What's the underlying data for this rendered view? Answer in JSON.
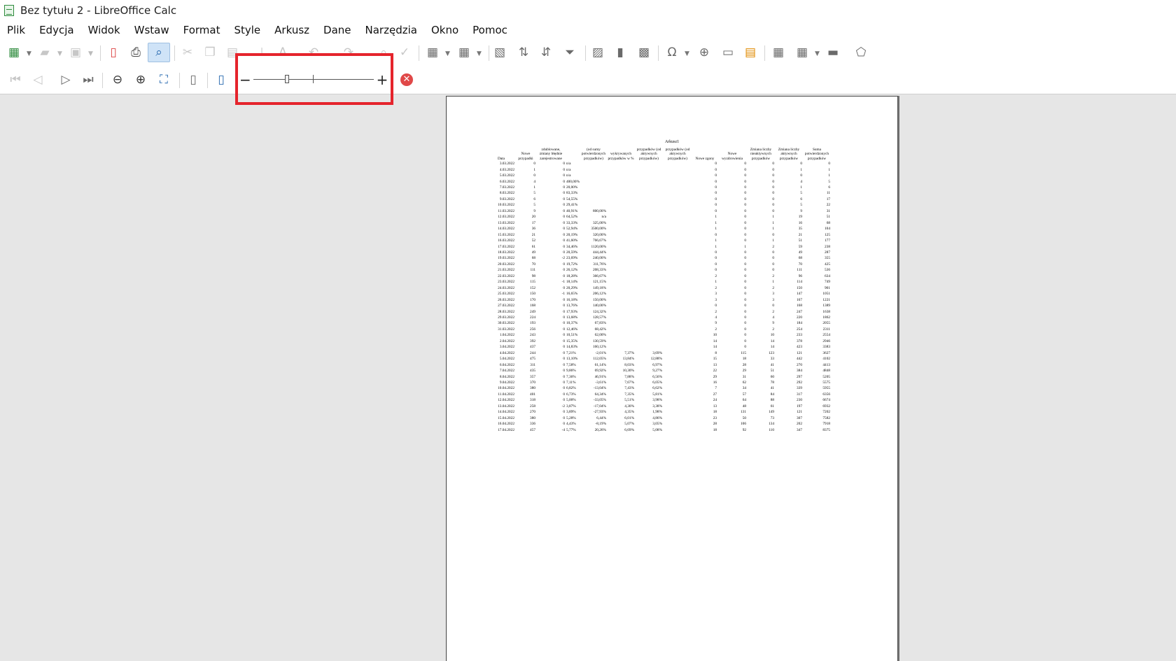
{
  "window": {
    "title": "Bez tytułu 2 - LibreOffice Calc"
  },
  "menu": [
    "Plik",
    "Edycja",
    "Widok",
    "Wstaw",
    "Format",
    "Style",
    "Arkusz",
    "Dane",
    "Narzędzia",
    "Okno",
    "Pomoc"
  ],
  "zoom": {
    "minus": "−",
    "plus": "+",
    "level": 0.3
  },
  "preview": {
    "sheet_name": "Arkusz1",
    "headers": [
      "Data",
      "Nowe przypadki",
      "zdublowane, zmiany błędnie zarejestrowane",
      "(od sumy potwierdzonych przypadków)",
      "wykrywanych przypadków w %",
      "przypadków (od aktywnych przypadków)",
      "przypadków (od aktywnych przypadków)",
      "Nowe zgony",
      "Nowe wyzdrowienia",
      "Zmiana liczby nieaktywnych przypadków",
      "Zmiana liczby aktywnych przypadków",
      "Suma potwierdzonych przypadków"
    ],
    "rows": [
      [
        "3.03.2022",
        "0",
        "0",
        "n/a",
        "",
        "",
        "",
        "",
        "0",
        "0",
        "0",
        "0",
        "0"
      ],
      [
        "4.03.2022",
        "1",
        "0",
        "n/a",
        "",
        "",
        "",
        "",
        "0",
        "0",
        "0",
        "1",
        "1"
      ],
      [
        "5.03.2022",
        "0",
        "0",
        "n/a",
        "",
        "",
        "",
        "",
        "0",
        "0",
        "0",
        "0",
        "1"
      ],
      [
        "6.03.2022",
        "4",
        "0",
        "400,00%",
        "",
        "",
        "",
        "",
        "0",
        "0",
        "0",
        "4",
        "5"
      ],
      [
        "7.03.2022",
        "1",
        "0",
        "20,00%",
        "",
        "",
        "",
        "",
        "0",
        "0",
        "0",
        "1",
        "6"
      ],
      [
        "8.03.2022",
        "5",
        "0",
        "83,33%",
        "",
        "",
        "",
        "",
        "0",
        "0",
        "0",
        "5",
        "11"
      ],
      [
        "9.03.2022",
        "6",
        "0",
        "54,55%",
        "",
        "",
        "",
        "",
        "0",
        "0",
        "0",
        "6",
        "17"
      ],
      [
        "10.03.2022",
        "5",
        "0",
        "29,41%",
        "",
        "",
        "",
        "",
        "0",
        "0",
        "0",
        "5",
        "22"
      ],
      [
        "11.03.2022",
        "9",
        "0",
        "40,91%",
        "800,00%",
        "",
        "",
        "",
        "0",
        "0",
        "0",
        "9",
        "31"
      ],
      [
        "12.03.2022",
        "20",
        "0",
        "64,52%",
        "n/a",
        "",
        "",
        "",
        "1",
        "0",
        "1",
        "19",
        "51"
      ],
      [
        "13.03.2022",
        "17",
        "0",
        "33,33%",
        "325,00%",
        "",
        "",
        "",
        "1",
        "0",
        "1",
        "16",
        "68"
      ],
      [
        "14.03.2022",
        "36",
        "0",
        "52,94%",
        "3500,00%",
        "",
        "",
        "",
        "1",
        "0",
        "1",
        "35",
        "104"
      ],
      [
        "15.03.2022",
        "21",
        "0",
        "20,19%",
        "320,00%",
        "",
        "",
        "",
        "0",
        "0",
        "0",
        "21",
        "125"
      ],
      [
        "16.03.2022",
        "52",
        "0",
        "41,60%",
        "766,67%",
        "",
        "",
        "",
        "1",
        "0",
        "1",
        "51",
        "177"
      ],
      [
        "17.03.2022",
        "61",
        "0",
        "34,46%",
        "1120,00%",
        "",
        "",
        "",
        "1",
        "1",
        "2",
        "59",
        "238"
      ],
      [
        "18.03.2022",
        "49",
        "0",
        "20,59%",
        "444,44%",
        "",
        "",
        "",
        "0",
        "0",
        "0",
        "49",
        "287"
      ],
      [
        "19.03.2022",
        "68",
        "-2",
        "23,69%",
        "240,00%",
        "",
        "",
        "",
        "0",
        "0",
        "0",
        "68",
        "355"
      ],
      [
        "20.03.2022",
        "70",
        "0",
        "19,72%",
        "311,76%",
        "",
        "",
        "",
        "0",
        "0",
        "0",
        "70",
        "425"
      ],
      [
        "21.03.2022",
        "111",
        "0",
        "26,12%",
        "208,33%",
        "",
        "",
        "",
        "0",
        "0",
        "0",
        "111",
        "536"
      ],
      [
        "22.03.2022",
        "98",
        "0",
        "18,28%",
        "366,67%",
        "",
        "",
        "",
        "2",
        "0",
        "2",
        "96",
        "634"
      ],
      [
        "23.03.2022",
        "115",
        "-1",
        "18,14%",
        "121,15%",
        "",
        "",
        "",
        "1",
        "0",
        "1",
        "114",
        "749"
      ],
      [
        "24.03.2022",
        "152",
        "0",
        "20,29%",
        "149,18%",
        "",
        "",
        "",
        "2",
        "0",
        "2",
        "150",
        "901"
      ],
      [
        "25.03.2022",
        "150",
        "-1",
        "16,65%",
        "206,12%",
        "",
        "",
        "",
        "3",
        "0",
        "3",
        "147",
        "1051"
      ],
      [
        "26.03.2022",
        "170",
        "0",
        "16,18%",
        "150,00%",
        "",
        "",
        "",
        "3",
        "0",
        "3",
        "167",
        "1221"
      ],
      [
        "27.03.2022",
        "168",
        "0",
        "13,76%",
        "140,00%",
        "",
        "",
        "",
        "0",
        "0",
        "0",
        "168",
        "1389"
      ],
      [
        "28.03.2022",
        "249",
        "0",
        "17,93%",
        "124,32%",
        "",
        "",
        "",
        "2",
        "0",
        "2",
        "247",
        "1638"
      ],
      [
        "29.03.2022",
        "224",
        "0",
        "13,68%",
        "128,57%",
        "",
        "",
        "",
        "4",
        "0",
        "4",
        "220",
        "1862"
      ],
      [
        "30.03.2022",
        "193",
        "0",
        "10,37%",
        "67,83%",
        "",
        "",
        "",
        "9",
        "0",
        "9",
        "184",
        "2055"
      ],
      [
        "31.03.2022",
        "256",
        "0",
        "12,46%",
        "68,42%",
        "",
        "",
        "",
        "2",
        "0",
        "2",
        "254",
        "2311"
      ],
      [
        "1.04.2022",
        "243",
        "0",
        "10,51%",
        "62,00%",
        "",
        "",
        "",
        "10",
        "0",
        "10",
        "233",
        "2554"
      ],
      [
        "2.04.2022",
        "392",
        "0",
        "15,35%",
        "130,59%",
        "",
        "",
        "",
        "14",
        "0",
        "14",
        "378",
        "2946"
      ],
      [
        "3.04.2022",
        "437",
        "0",
        "14,83%",
        "160,12%",
        "",
        "",
        "",
        "14",
        "0",
        "14",
        "423",
        "3383"
      ],
      [
        "4.04.2022",
        "244",
        "0",
        "7,21%",
        "-2,01%",
        "7,37%",
        "3,69%",
        "",
        "8",
        "115",
        "123",
        "121",
        "3627"
      ],
      [
        "5.04.2022",
        "475",
        "0",
        "13,10%",
        "112,05%",
        "13,84%",
        "12,88%",
        "",
        "15",
        "18",
        "33",
        "442",
        "4102"
      ],
      [
        "6.04.2022",
        "311",
        "0",
        "7,58%",
        "61,14%",
        "8,03%",
        "6,97%",
        "",
        "13",
        "28",
        "41",
        "270",
        "4413"
      ],
      [
        "7.04.2022",
        "435",
        "0",
        "9,86%",
        "69,92%",
        "10,30%",
        "9,27%",
        "",
        "22",
        "29",
        "51",
        "384",
        "4848"
      ],
      [
        "8.04.2022",
        "357",
        "0",
        "7,36%",
        "46,91%",
        "7,88%",
        "6,56%",
        "",
        "29",
        "31",
        "60",
        "297",
        "5205"
      ],
      [
        "9.04.2022",
        "370",
        "0",
        "7,11%",
        "-3,61%",
        "7,67%",
        "6,05%",
        "",
        "16",
        "62",
        "78",
        "292",
        "5575"
      ],
      [
        "10.04.2022",
        "380",
        "0",
        "6,82%",
        "-13,04%",
        "7,43%",
        "6,62%",
        "",
        "7",
        "34",
        "41",
        "339",
        "5955"
      ],
      [
        "11.04.2022",
        "401",
        "0",
        "6,73%",
        "64,34%",
        "7,35%",
        "5,81%",
        "",
        "27",
        "57",
        "84",
        "317",
        "6356"
      ],
      [
        "12.04.2022",
        "318",
        "0",
        "5,00%",
        "-33,05%",
        "5,51%",
        "3,98%",
        "",
        "24",
        "64",
        "88",
        "230",
        "6674"
      ],
      [
        "13.04.2022",
        "258",
        "-2",
        "3,87%",
        "-17,04%",
        "4,30%",
        "3,38%",
        "",
        "13",
        "48",
        "61",
        "197",
        "6932"
      ],
      [
        "14.04.2022",
        "270",
        "0",
        "3,89%",
        "-27,93%",
        "4,35%",
        "1,98%",
        "",
        "18",
        "131",
        "149",
        "121",
        "7202"
      ],
      [
        "15.04.2022",
        "380",
        "0",
        "5,28%",
        "6,44%",
        "6,01%",
        "4,86%",
        "",
        "23",
        "50",
        "73",
        "307",
        "7582"
      ],
      [
        "16.04.2022",
        "336",
        "0",
        "4,43%",
        "-8,19%",
        "5,07%",
        "3,05%",
        "",
        "28",
        "106",
        "134",
        "202",
        "7918"
      ],
      [
        "17.04.2022",
        "457",
        "-4",
        "5,77%",
        "20,26%",
        "6,69%",
        "5,08%",
        "",
        "18",
        "92",
        "110",
        "347",
        "8375"
      ]
    ]
  }
}
